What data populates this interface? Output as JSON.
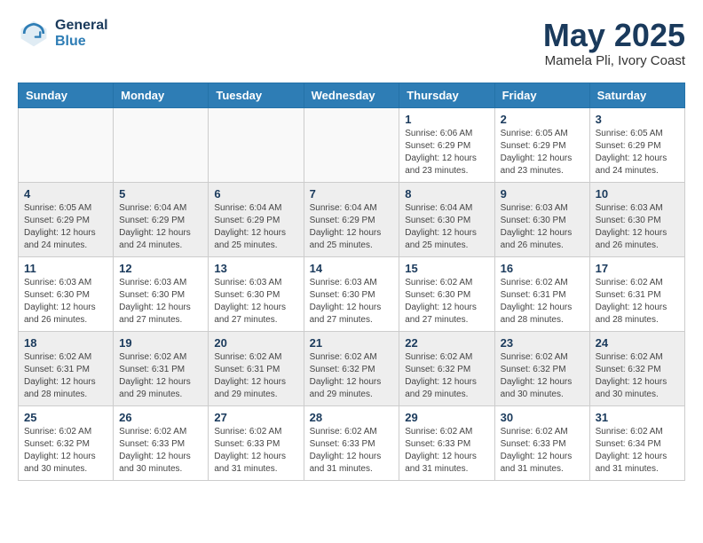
{
  "header": {
    "logo_line1": "General",
    "logo_line2": "Blue",
    "month_year": "May 2025",
    "location": "Mamela Pli, Ivory Coast"
  },
  "weekdays": [
    "Sunday",
    "Monday",
    "Tuesday",
    "Wednesday",
    "Thursday",
    "Friday",
    "Saturday"
  ],
  "weeks": [
    [
      {
        "day": "",
        "info": ""
      },
      {
        "day": "",
        "info": ""
      },
      {
        "day": "",
        "info": ""
      },
      {
        "day": "",
        "info": ""
      },
      {
        "day": "1",
        "info": "Sunrise: 6:06 AM\nSunset: 6:29 PM\nDaylight: 12 hours\nand 23 minutes."
      },
      {
        "day": "2",
        "info": "Sunrise: 6:05 AM\nSunset: 6:29 PM\nDaylight: 12 hours\nand 23 minutes."
      },
      {
        "day": "3",
        "info": "Sunrise: 6:05 AM\nSunset: 6:29 PM\nDaylight: 12 hours\nand 24 minutes."
      }
    ],
    [
      {
        "day": "4",
        "info": "Sunrise: 6:05 AM\nSunset: 6:29 PM\nDaylight: 12 hours\nand 24 minutes."
      },
      {
        "day": "5",
        "info": "Sunrise: 6:04 AM\nSunset: 6:29 PM\nDaylight: 12 hours\nand 24 minutes."
      },
      {
        "day": "6",
        "info": "Sunrise: 6:04 AM\nSunset: 6:29 PM\nDaylight: 12 hours\nand 25 minutes."
      },
      {
        "day": "7",
        "info": "Sunrise: 6:04 AM\nSunset: 6:29 PM\nDaylight: 12 hours\nand 25 minutes."
      },
      {
        "day": "8",
        "info": "Sunrise: 6:04 AM\nSunset: 6:30 PM\nDaylight: 12 hours\nand 25 minutes."
      },
      {
        "day": "9",
        "info": "Sunrise: 6:03 AM\nSunset: 6:30 PM\nDaylight: 12 hours\nand 26 minutes."
      },
      {
        "day": "10",
        "info": "Sunrise: 6:03 AM\nSunset: 6:30 PM\nDaylight: 12 hours\nand 26 minutes."
      }
    ],
    [
      {
        "day": "11",
        "info": "Sunrise: 6:03 AM\nSunset: 6:30 PM\nDaylight: 12 hours\nand 26 minutes."
      },
      {
        "day": "12",
        "info": "Sunrise: 6:03 AM\nSunset: 6:30 PM\nDaylight: 12 hours\nand 27 minutes."
      },
      {
        "day": "13",
        "info": "Sunrise: 6:03 AM\nSunset: 6:30 PM\nDaylight: 12 hours\nand 27 minutes."
      },
      {
        "day": "14",
        "info": "Sunrise: 6:03 AM\nSunset: 6:30 PM\nDaylight: 12 hours\nand 27 minutes."
      },
      {
        "day": "15",
        "info": "Sunrise: 6:02 AM\nSunset: 6:30 PM\nDaylight: 12 hours\nand 27 minutes."
      },
      {
        "day": "16",
        "info": "Sunrise: 6:02 AM\nSunset: 6:31 PM\nDaylight: 12 hours\nand 28 minutes."
      },
      {
        "day": "17",
        "info": "Sunrise: 6:02 AM\nSunset: 6:31 PM\nDaylight: 12 hours\nand 28 minutes."
      }
    ],
    [
      {
        "day": "18",
        "info": "Sunrise: 6:02 AM\nSunset: 6:31 PM\nDaylight: 12 hours\nand 28 minutes."
      },
      {
        "day": "19",
        "info": "Sunrise: 6:02 AM\nSunset: 6:31 PM\nDaylight: 12 hours\nand 29 minutes."
      },
      {
        "day": "20",
        "info": "Sunrise: 6:02 AM\nSunset: 6:31 PM\nDaylight: 12 hours\nand 29 minutes."
      },
      {
        "day": "21",
        "info": "Sunrise: 6:02 AM\nSunset: 6:32 PM\nDaylight: 12 hours\nand 29 minutes."
      },
      {
        "day": "22",
        "info": "Sunrise: 6:02 AM\nSunset: 6:32 PM\nDaylight: 12 hours\nand 29 minutes."
      },
      {
        "day": "23",
        "info": "Sunrise: 6:02 AM\nSunset: 6:32 PM\nDaylight: 12 hours\nand 30 minutes."
      },
      {
        "day": "24",
        "info": "Sunrise: 6:02 AM\nSunset: 6:32 PM\nDaylight: 12 hours\nand 30 minutes."
      }
    ],
    [
      {
        "day": "25",
        "info": "Sunrise: 6:02 AM\nSunset: 6:32 PM\nDaylight: 12 hours\nand 30 minutes."
      },
      {
        "day": "26",
        "info": "Sunrise: 6:02 AM\nSunset: 6:33 PM\nDaylight: 12 hours\nand 30 minutes."
      },
      {
        "day": "27",
        "info": "Sunrise: 6:02 AM\nSunset: 6:33 PM\nDaylight: 12 hours\nand 31 minutes."
      },
      {
        "day": "28",
        "info": "Sunrise: 6:02 AM\nSunset: 6:33 PM\nDaylight: 12 hours\nand 31 minutes."
      },
      {
        "day": "29",
        "info": "Sunrise: 6:02 AM\nSunset: 6:33 PM\nDaylight: 12 hours\nand 31 minutes."
      },
      {
        "day": "30",
        "info": "Sunrise: 6:02 AM\nSunset: 6:33 PM\nDaylight: 12 hours\nand 31 minutes."
      },
      {
        "day": "31",
        "info": "Sunrise: 6:02 AM\nSunset: 6:34 PM\nDaylight: 12 hours\nand 31 minutes."
      }
    ]
  ]
}
